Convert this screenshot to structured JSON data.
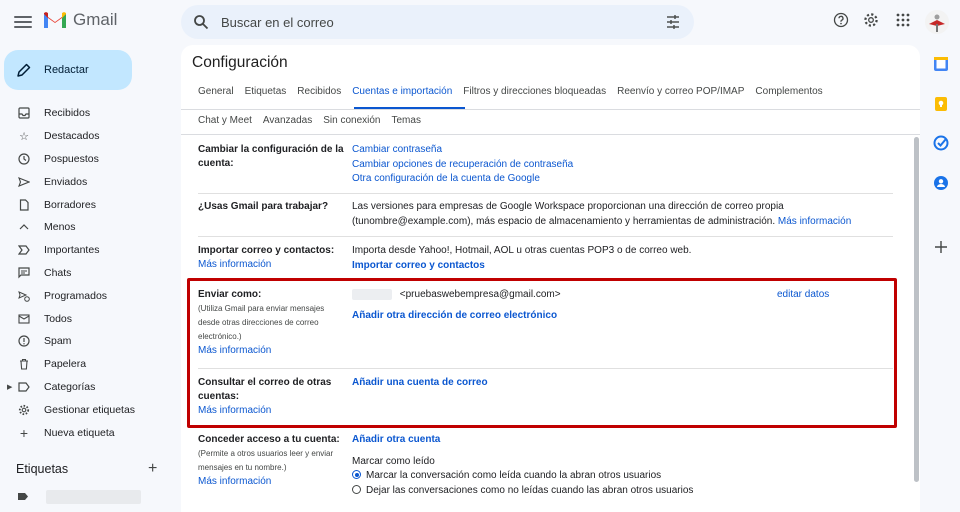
{
  "header": {
    "app_name": "Gmail",
    "search_placeholder": "Buscar en el correo"
  },
  "compose_label": "Redactar",
  "sidebar": {
    "items": [
      {
        "label": "Recibidos",
        "icon": "inbox-icon"
      },
      {
        "label": "Destacados",
        "icon": "star-icon"
      },
      {
        "label": "Pospuestos",
        "icon": "clock-icon"
      },
      {
        "label": "Enviados",
        "icon": "send-icon"
      },
      {
        "label": "Borradores",
        "icon": "draft-icon"
      },
      {
        "label": "Menos",
        "icon": "chevron-up-icon"
      },
      {
        "label": "Importantes",
        "icon": "important-icon"
      },
      {
        "label": "Chats",
        "icon": "chat-icon"
      },
      {
        "label": "Programados",
        "icon": "scheduled-send-icon"
      },
      {
        "label": "Todos",
        "icon": "all-mail-icon"
      },
      {
        "label": "Spam",
        "icon": "spam-icon"
      },
      {
        "label": "Papelera",
        "icon": "trash-icon"
      },
      {
        "label": "Categorías",
        "icon": "label-outline-icon"
      },
      {
        "label": "Gestionar etiquetas",
        "icon": "gear-icon"
      },
      {
        "label": "Nueva etiqueta",
        "icon": "plus-icon"
      }
    ],
    "labels_title": "Etiquetas",
    "labels_add": "+"
  },
  "settings": {
    "title": "Configuración",
    "tabs_row1": [
      "General",
      "Etiquetas",
      "Recibidos",
      "Cuentas e importación",
      "Filtros y direcciones bloqueadas",
      "Reenvío y correo POP/IMAP",
      "Complementos"
    ],
    "tabs_row2": [
      "Chat y Meet",
      "Avanzadas",
      "Sin conexión",
      "Temas"
    ],
    "active_tab": "Cuentas e importación",
    "sections": {
      "change_account": {
        "label": "Cambiar la configuración de la cuenta:",
        "links": [
          "Cambiar contraseña",
          "Cambiar opciones de recuperación de contraseña",
          "Otra configuración de la cuenta de Google"
        ]
      },
      "workspace": {
        "label": "¿Usas Gmail para trabajar?",
        "text": "Las versiones para empresas de Google Workspace proporcionan una dirección de correo propia (tunombre@example.com), más espacio de almacenamiento y herramientas de administración.",
        "link": "Más información"
      },
      "import": {
        "label": "Importar correo y contactos:",
        "more": "Más información",
        "text": "Importa desde Yahoo!, Hotmail, AOL u otras cuentas POP3 o de correo web.",
        "action": "Importar correo y contactos"
      },
      "send_as": {
        "label": "Enviar como:",
        "note": "(Utiliza Gmail para enviar mensajes desde otras direcciones de correo electrónico.)",
        "more": "Más información",
        "email": "<pruebaswebempresa@gmail.com>",
        "edit": "editar datos",
        "action": "Añadir otra dirección de correo electrónico"
      },
      "check_mail": {
        "label": "Consultar el correo de otras cuentas:",
        "more": "Más información",
        "action": "Añadir una cuenta de correo"
      },
      "grant_access": {
        "label": "Conceder acceso a tu cuenta:",
        "note": "(Permite a otros usuarios leer y enviar mensajes en tu nombre.)",
        "more": "Más información",
        "action": "Añadir otra cuenta",
        "mark_title": "Marcar como leído",
        "options": [
          "Marcar la conversación como leída cuando la abran otros usuarios",
          "Dejar las conversaciones como no leídas cuando las abran otros usuarios"
        ],
        "selected_index": 0
      }
    }
  },
  "colors": {
    "accent": "#0b57d0",
    "highlight": "#c00000",
    "compose": "#c2e7ff"
  }
}
